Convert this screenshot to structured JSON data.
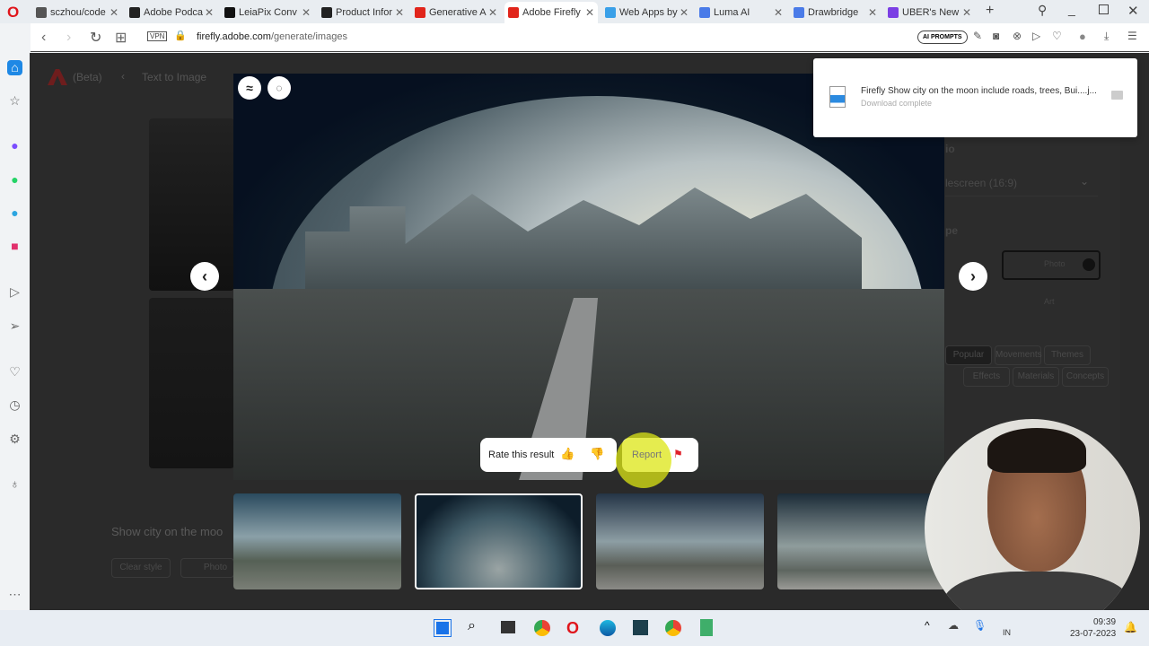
{
  "browser": {
    "tabs": [
      {
        "label": "sczhou/code",
        "color": "#555"
      },
      {
        "label": "Adobe Podca",
        "color": "#222"
      },
      {
        "label": "LeiaPix Conv",
        "color": "#111"
      },
      {
        "label": "Product Infor",
        "color": "#222"
      },
      {
        "label": "Generative A",
        "color": "#e1251b"
      },
      {
        "label": "Adobe Firefly",
        "color": "#e1251b",
        "active": true
      },
      {
        "label": "Web Apps by",
        "color": "#3aa0e8"
      },
      {
        "label": "Luma AI",
        "color": "#4a7be8"
      },
      {
        "label": "Drawbridge",
        "color": "#4a7be8"
      },
      {
        "label": "UBER's New",
        "color": "#7b3fe4"
      }
    ],
    "url_host": "firefly.adobe.com",
    "url_path": "/generate/images",
    "vpn": "VPN",
    "ai_prompts": "AI PROMPTS"
  },
  "download": {
    "filename": "Firefly Show city on the moon include roads, trees, Bui....j...",
    "status": "Download complete"
  },
  "app": {
    "beta": "(Beta)",
    "back_title": "Text to Image",
    "prompt": "Show city on the moo",
    "clear_style": "Clear style",
    "style_chip": "Photo",
    "aspect_heading": "io",
    "aspect_value": "lescreen (16:9)",
    "content_type_heading": "pe",
    "content_photo": "Photo",
    "content_art": "Art",
    "style_tabs": [
      "Popular",
      "Movements",
      "Themes"
    ],
    "style_tabs2": [
      "Effects",
      "Materials",
      "Concepts"
    ]
  },
  "viewer": {
    "rate_label": "Rate this result",
    "report_label": "Report"
  },
  "taskbar": {
    "time": "09:39",
    "date": "23-07-2023",
    "lang": "IN"
  }
}
